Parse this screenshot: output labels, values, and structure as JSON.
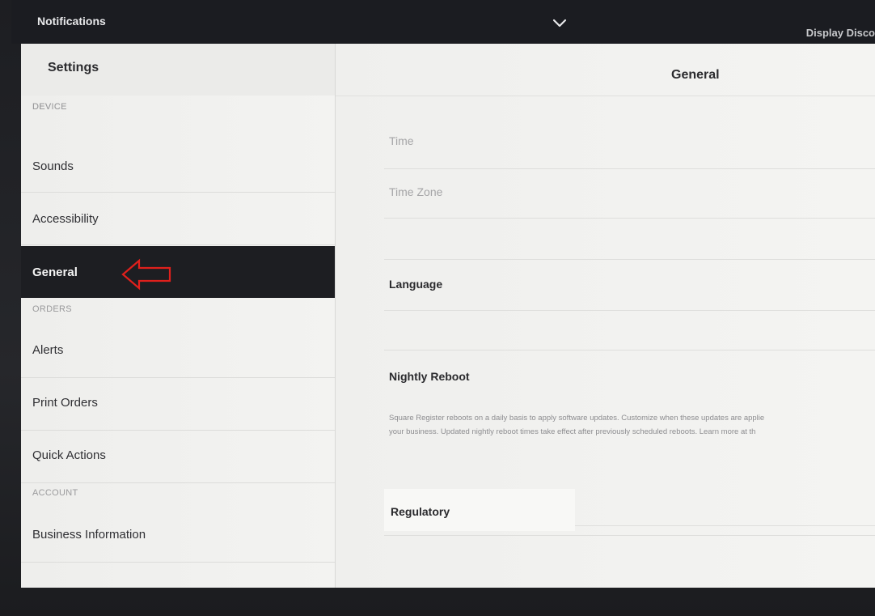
{
  "topbar": {
    "left_title": "Notifications",
    "right_title": "Display Disco",
    "dropdown_icon": "chevron-down-icon"
  },
  "sidebar": {
    "title": "Settings",
    "sections": {
      "device": "DEVICE",
      "orders": "ORDERS",
      "account": "ACCOUNT"
    },
    "items": {
      "sounds": "Sounds",
      "accessibility": "Accessibility",
      "general": "General",
      "alerts": "Alerts",
      "print_orders": "Print Orders",
      "quick_actions": "Quick Actions",
      "business_information": "Business Information"
    },
    "active_item": "General",
    "annotation_color": "#e0201c"
  },
  "content": {
    "title": "General",
    "rows": {
      "time": "Time",
      "time_zone": "Time Zone",
      "language": "Language",
      "nightly_reboot": "Nightly Reboot",
      "regulatory": "Regulatory"
    },
    "nightly_reboot_description": {
      "line1": "Square Register reboots on a daily basis to apply software updates. Customize when these updates are applie",
      "line2": "your business. Updated nightly reboot times take effect after previously scheduled reboots. Learn more at th"
    }
  },
  "colors": {
    "active_bg": "#1d1e22",
    "screen_bg": "#f1f1ef",
    "bezel": "#1b1c21"
  }
}
